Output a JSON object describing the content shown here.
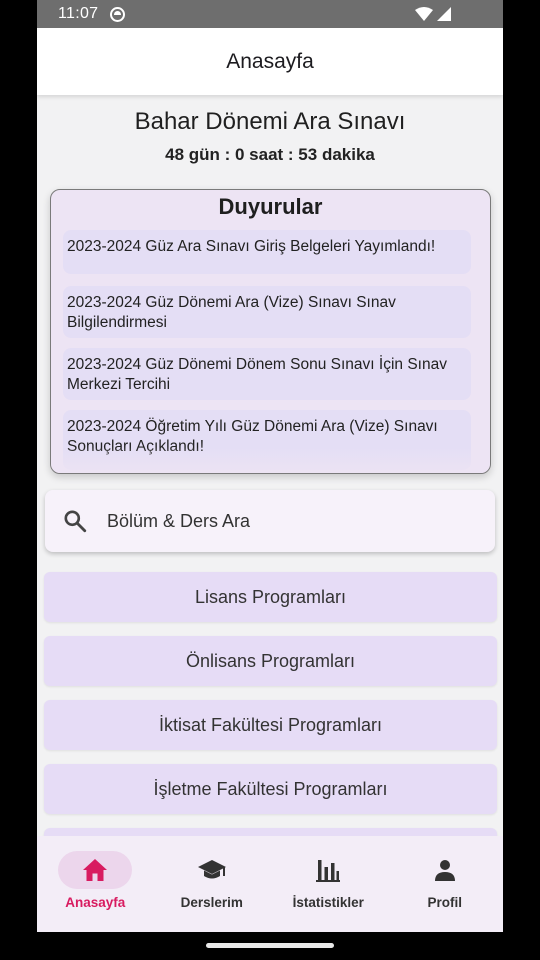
{
  "status_bar": {
    "time": "11:07"
  },
  "app_bar": {
    "title": "Anasayfa"
  },
  "exam": {
    "title": "Bahar Dönemi Ara Sınavı",
    "countdown": "48 gün : 0 saat : 53 dakika"
  },
  "announcements": {
    "title": "Duyurular",
    "items": [
      "2023-2024 Güz Ara Sınavı Giriş Belgeleri Yayımlandı!",
      "2023-2024 Güz Dönemi Ara (Vize) Sınavı Sınav Bilgilendirmesi",
      "2023-2024 Güz Dönemi Dönem Sonu Sınavı İçin Sınav Merkezi Tercihi",
      "2023-2024 Öğretim Yılı Güz Dönemi Ara (Vize) Sınavı Sonuçları Açıklandı!"
    ]
  },
  "search": {
    "placeholder": "Bölüm & Ders Ara",
    "icon": "search-icon"
  },
  "programs": [
    "Lisans Programları",
    "Önlisans Programları",
    "İktisat Fakültesi Programları",
    "İşletme Fakültesi Programları"
  ],
  "bottom_nav": [
    {
      "label": "Anasayfa",
      "icon": "home-icon",
      "active": true
    },
    {
      "label": "Derslerim",
      "icon": "school-icon",
      "active": false
    },
    {
      "label": "İstatistikler",
      "icon": "bar-chart-icon",
      "active": false
    },
    {
      "label": "Profil",
      "icon": "person-icon",
      "active": false
    }
  ],
  "colors": {
    "accent": "#d81b60",
    "card_bg": "#ede4f4",
    "item_bg": "#e4def5",
    "button_bg": "#e6dcf6",
    "nav_bg": "#f3edf7"
  }
}
